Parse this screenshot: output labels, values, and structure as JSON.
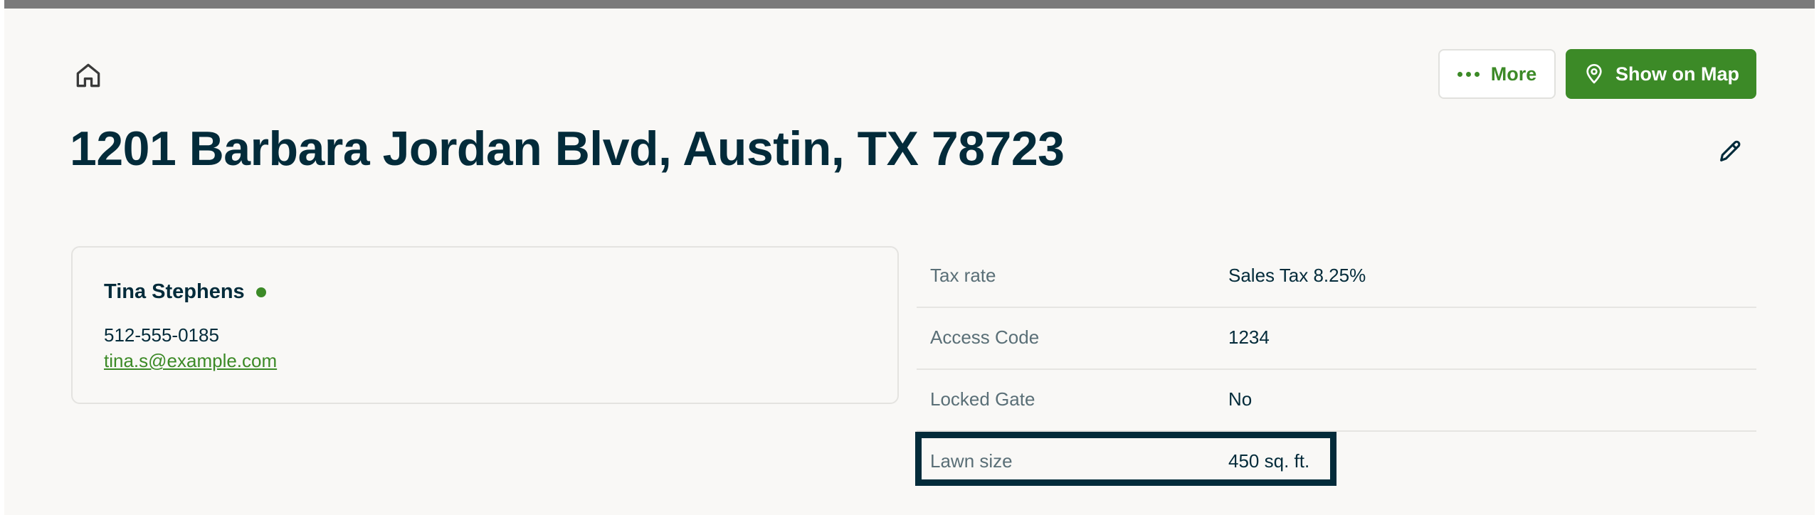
{
  "header": {
    "more_label": "More",
    "map_label": "Show on Map"
  },
  "property": {
    "address": "1201 Barbara Jordan Blvd, Austin, TX 78723"
  },
  "client": {
    "name": "Tina Stephens",
    "status_color": "#3c8a27",
    "phone": "512-555-0185",
    "email": "tina.s@example.com"
  },
  "details": [
    {
      "label": "Tax rate",
      "value": "Sales Tax 8.25%"
    },
    {
      "label": "Access Code",
      "value": "1234"
    },
    {
      "label": "Locked Gate",
      "value": "No"
    },
    {
      "label": "Lawn size",
      "value": "450 sq. ft."
    }
  ],
  "colors": {
    "brand_green": "#3c8a27",
    "heading_navy": "#032b3a",
    "background": "#f9f8f6"
  },
  "icons": [
    "home-icon",
    "more-dots-icon",
    "map-pin-icon",
    "pencil-icon"
  ]
}
